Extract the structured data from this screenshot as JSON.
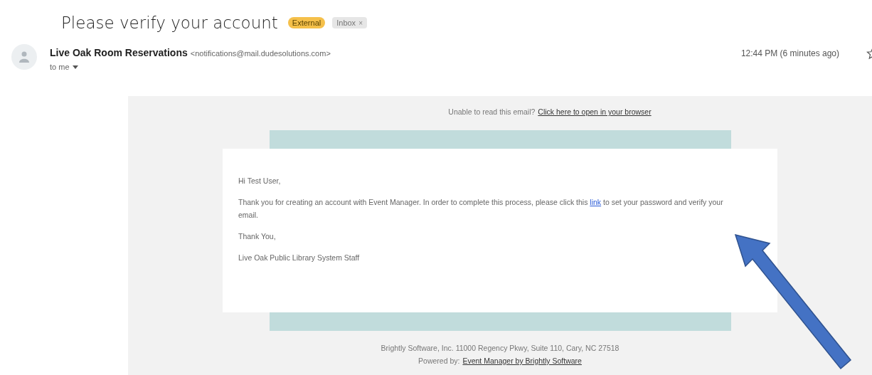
{
  "subject": "Please verify your account",
  "labels": [
    {
      "text": "External",
      "kind": "external"
    },
    {
      "text": "Inbox",
      "kind": "folder",
      "close": "×"
    }
  ],
  "sender": {
    "name": "Live Oak Room Reservations",
    "address": "<notifications@mail.dudesolutions.com>",
    "recipient": "to me",
    "time": "12:44 PM (6 minutes ago)",
    "starred": false
  },
  "email": {
    "preheader": "Unable to read this email?",
    "browser_link": "Click here to open in your browser",
    "greeting": "Hi Test User,",
    "body_before": "Thank you for creating an account with Event Manager. In order to complete this process, please click this",
    "body_link": "link",
    "body_after": "to set your password and verify your email.",
    "closing": "Thank You,",
    "signature": "Live Oak Public Library System Staff",
    "footer_address": "Brightly Software, Inc. 11000 Regency Pkwy, Suite 110, Cary, NC 27518",
    "footer_prefix": "Powered by:",
    "footer_link": "Event Manager by Brightly Software"
  }
}
